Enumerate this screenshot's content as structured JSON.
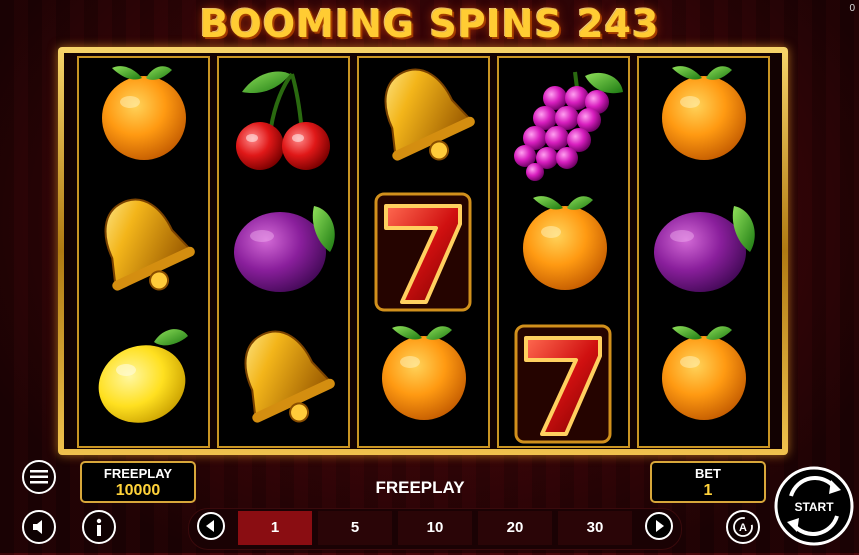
{
  "game": {
    "title": "BOOMING SPINS 243",
    "top_right_counter": "0"
  },
  "reels": [
    [
      "orange",
      "bell",
      "lemon"
    ],
    [
      "cherry",
      "plum",
      "bell"
    ],
    [
      "bell",
      "seven",
      "orange"
    ],
    [
      "grapes",
      "orange",
      "seven"
    ],
    [
      "orange",
      "plum",
      "orange"
    ]
  ],
  "hud": {
    "freeplay_label": "FREEPLAY",
    "freeplay_value": "10000",
    "status_text": "FREEPLAY",
    "bet_label": "BET",
    "bet_value": "1",
    "start_label": "START"
  },
  "bet_options": [
    "1",
    "5",
    "10",
    "20",
    "30"
  ],
  "selected_bet": "1",
  "icons": [
    "menu-icon",
    "sound-icon",
    "info-icon",
    "autoplay-icon",
    "prev-arrow-icon",
    "next-arrow-icon"
  ],
  "colors": {
    "gold": "#d8a73a",
    "selected_bet": "#8a0d12",
    "value_yellow": "#ffd23a"
  }
}
